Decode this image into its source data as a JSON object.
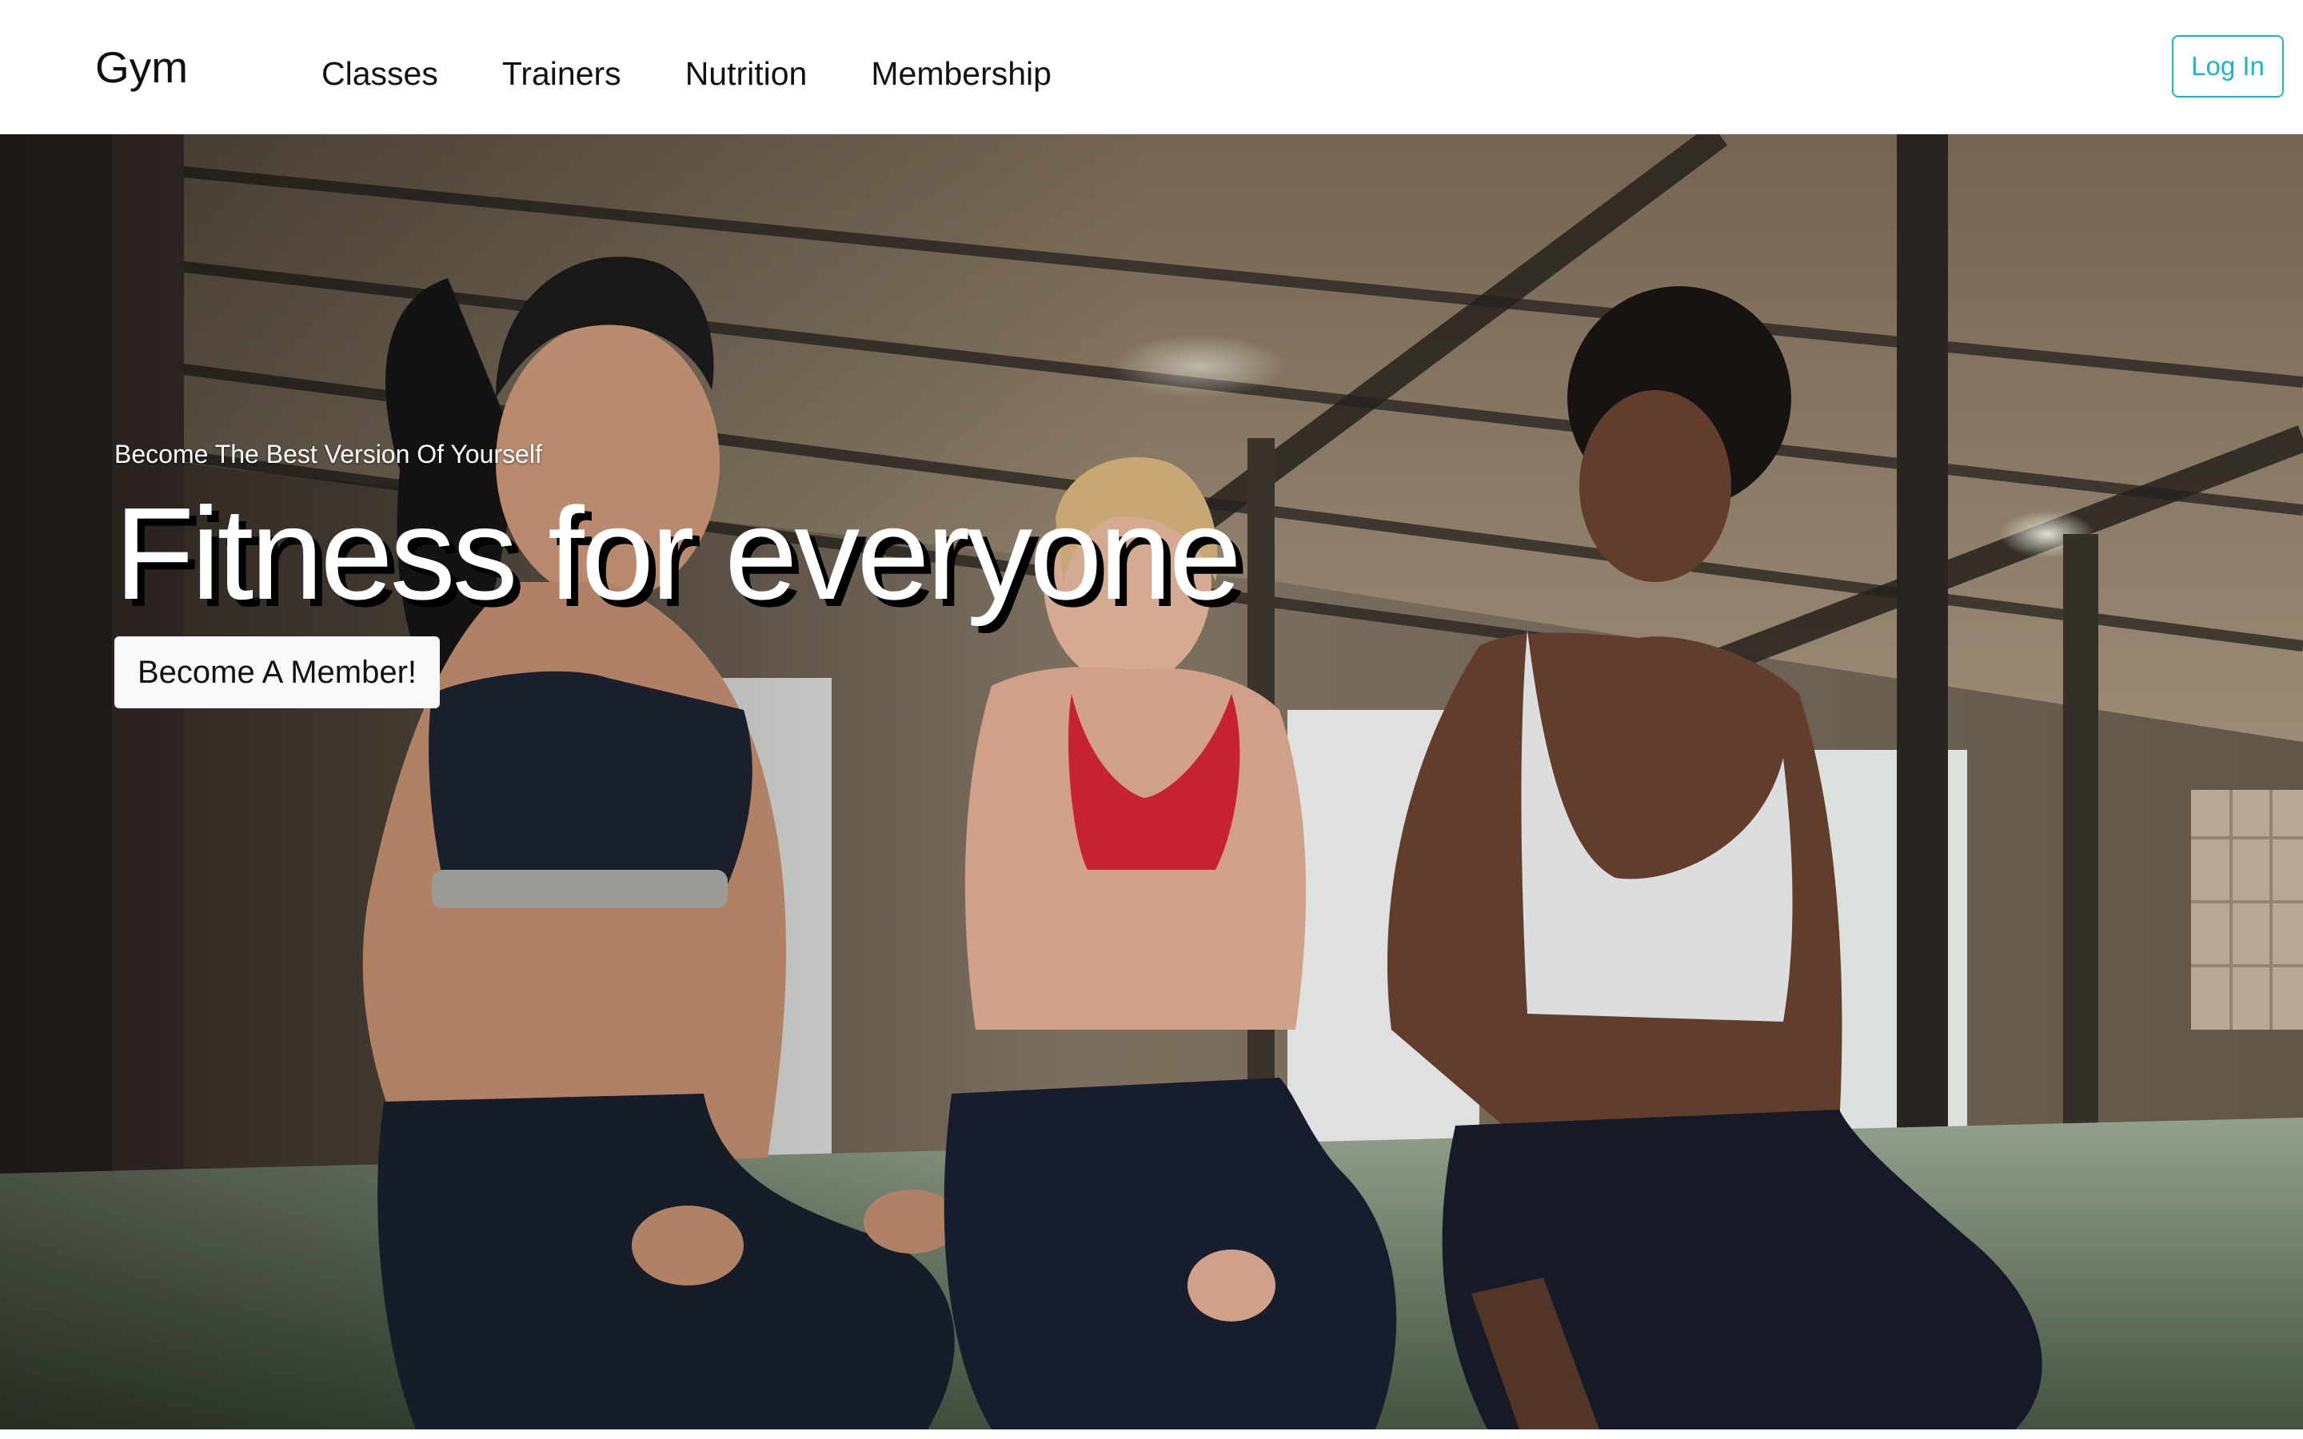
{
  "navbar": {
    "brand": "Gym",
    "links": [
      "Classes",
      "Trainers",
      "Nutrition",
      "Membership"
    ],
    "login_label": "Log In",
    "accent_color": "#17b5d6"
  },
  "hero": {
    "background_image": "photo of three smiling women in sportswear kneeling on the floor of a brick-walled gym with large windows",
    "eyebrow": "Become The Best Version Of Yourself",
    "headline": "Fitness for everyone",
    "cta_label": "Become A Member!"
  }
}
